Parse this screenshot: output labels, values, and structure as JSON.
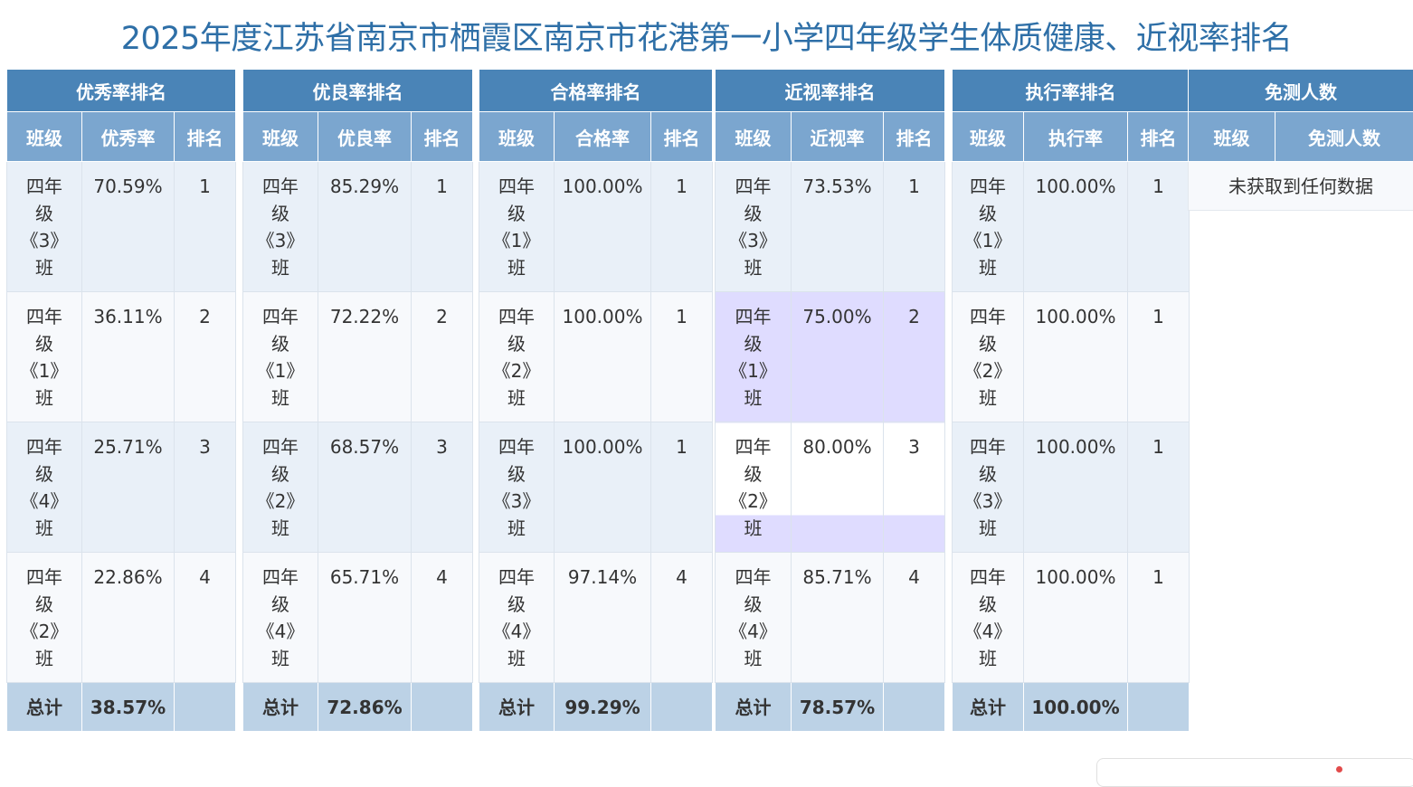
{
  "page_title": "2025年度江苏省南京市栖霞区南京市花港第一小学四年级学生体质健康、近视率排名",
  "class_suffix": "班",
  "class_parts": [
    "四年",
    "级"
  ],
  "total_label": "总计",
  "panels": [
    {
      "key": "excellent",
      "group_label": "优秀率排名",
      "headers": [
        "班级",
        "优秀率",
        "排名"
      ],
      "rows": [
        {
          "cls": "《3》",
          "rate": "70.59%",
          "rank": "1"
        },
        {
          "cls": "《1》",
          "rate": "36.11%",
          "rank": "2"
        },
        {
          "cls": "《4》",
          "rate": "25.71%",
          "rank": "3"
        },
        {
          "cls": "《2》",
          "rate": "22.86%",
          "rank": "4"
        }
      ],
      "total": "38.57%"
    },
    {
      "key": "good",
      "group_label": "优良率排名",
      "headers": [
        "班级",
        "优良率",
        "排名"
      ],
      "rows": [
        {
          "cls": "《3》",
          "rate": "85.29%",
          "rank": "1"
        },
        {
          "cls": "《1》",
          "rate": "72.22%",
          "rank": "2"
        },
        {
          "cls": "《2》",
          "rate": "68.57%",
          "rank": "3"
        },
        {
          "cls": "《4》",
          "rate": "65.71%",
          "rank": "4"
        }
      ],
      "total": "72.86%"
    },
    {
      "key": "pass",
      "group_label": "合格率排名",
      "headers": [
        "班级",
        "合格率",
        "排名"
      ],
      "rows": [
        {
          "cls": "《1》",
          "rate": "100.00%",
          "rank": "1"
        },
        {
          "cls": "《2》",
          "rate": "100.00%",
          "rank": "1"
        },
        {
          "cls": "《3》",
          "rate": "100.00%",
          "rank": "1"
        },
        {
          "cls": "《4》",
          "rate": "97.14%",
          "rank": "4"
        }
      ],
      "total": "99.29%"
    },
    {
      "key": "myopia",
      "group_label": "近视率排名",
      "headers": [
        "班级",
        "近视率",
        "排名"
      ],
      "rows": [
        {
          "cls": "《3》",
          "rate": "73.53%",
          "rank": "1"
        },
        {
          "cls": "《1》",
          "rate": "75.00%",
          "rank": "2"
        },
        {
          "cls": "《2》",
          "rate": "80.00%",
          "rank": "3"
        },
        {
          "cls": "《4》",
          "rate": "85.71%",
          "rank": "4"
        }
      ],
      "total": "78.57%"
    },
    {
      "key": "exec",
      "group_label": "执行率排名",
      "headers": [
        "班级",
        "执行率",
        "排名"
      ],
      "rows": [
        {
          "cls": "《1》",
          "rate": "100.00%",
          "rank": "1"
        },
        {
          "cls": "《2》",
          "rate": "100.00%",
          "rank": "1"
        },
        {
          "cls": "《3》",
          "rate": "100.00%",
          "rank": "1"
        },
        {
          "cls": "《4》",
          "rate": "100.00%",
          "rank": "1"
        }
      ],
      "total": "100.00%"
    }
  ],
  "exempt": {
    "group_label": "免测人数",
    "headers": [
      "班级",
      "免测人数"
    ],
    "empty_text": "未获取到任何数据"
  },
  "colors": {
    "title": "#2e6fa7",
    "group_header": "#4a84b7",
    "col_header": "#7ba6cf",
    "row_odd": "#e9f0f8",
    "row_even": "#f7f9fc",
    "row_highlight": "#dfdcff",
    "total_row": "#bcd2e6"
  }
}
